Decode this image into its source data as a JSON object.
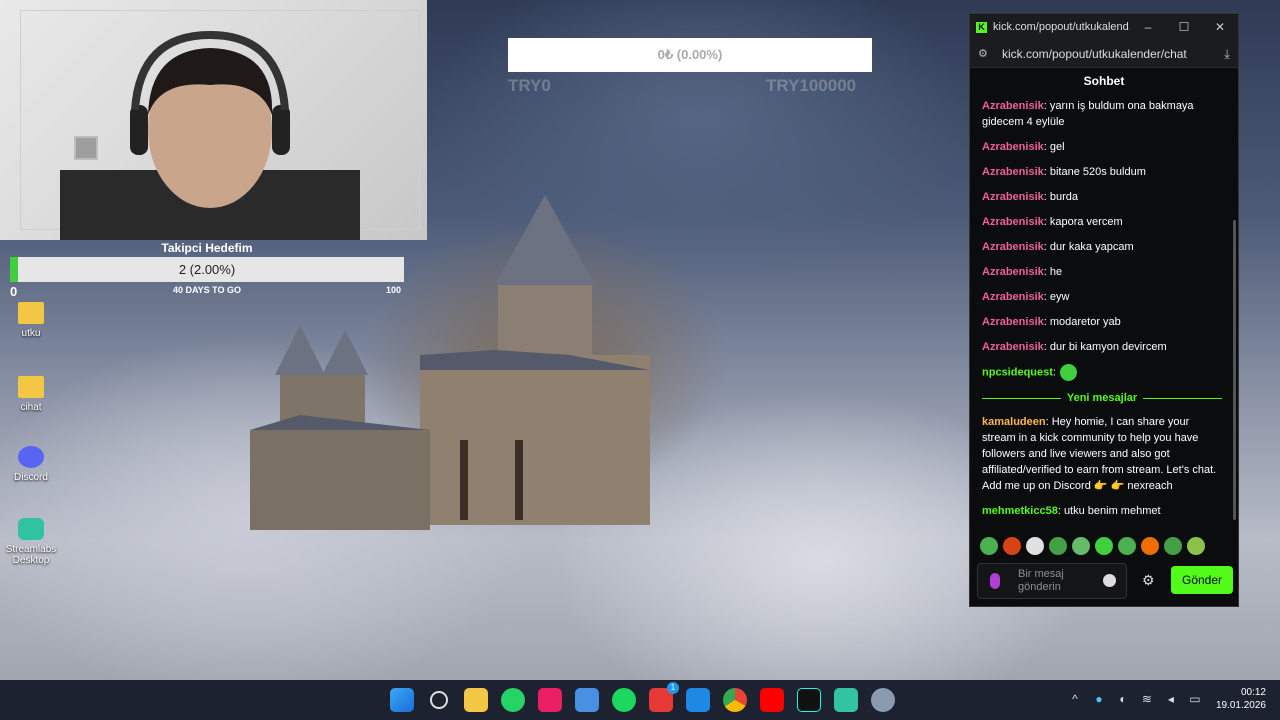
{
  "webcam": {
    "label": "webcam-feed"
  },
  "donation_goal": {
    "value": "0₺ (0.00%)",
    "min": "TRY0",
    "max": "TRY100000"
  },
  "follower_goal": {
    "title": "Takipci Hedefim",
    "value": "2 (2.00%)",
    "progress": 0.02,
    "min": "0",
    "days": "40 DAYS TO GO",
    "max": "100"
  },
  "desktop_icons": [
    {
      "label": "utku",
      "icon": "folder-icon"
    },
    {
      "label": "cihat",
      "icon": "folder-icon"
    },
    {
      "label": "Discord",
      "icon": "discord-icon"
    },
    {
      "label": "Streamlabs Desktop",
      "icon": "streamlabs-icon"
    }
  ],
  "popup": {
    "window_title": "kick.com/popout/utkukalend...",
    "url": "kick.com/popout/utkukalender/chat",
    "header": "Sohbet",
    "messages": [
      {
        "user": "Azrabenisik",
        "color": "#f06292",
        "text": ": yarın iş buldum ona bakmaya gidecem 4 eylüle"
      },
      {
        "user": "Azrabenisik",
        "color": "#f06292",
        "text": ": gel"
      },
      {
        "user": "Azrabenisik",
        "color": "#f06292",
        "text": ": bitane 520s buldum"
      },
      {
        "user": "Azrabenisik",
        "color": "#f06292",
        "text": ": burda"
      },
      {
        "user": "Azrabenisik",
        "color": "#f06292",
        "text": ": kapora vercem"
      },
      {
        "user": "Azrabenisik",
        "color": "#f06292",
        "text": ": dur kaka yapcam"
      },
      {
        "user": "Azrabenisik",
        "color": "#f06292",
        "text": ": he"
      },
      {
        "user": "Azrabenisik",
        "color": "#f06292",
        "text": ": eyw"
      },
      {
        "user": "Azrabenisik",
        "color": "#f06292",
        "text": ": modaretor yab"
      },
      {
        "user": "Azrabenisik",
        "color": "#f06292",
        "text": ": dur bi kamyon devircem"
      },
      {
        "user": "npcsidequest",
        "color": "#53fc18",
        "text": ":"
      }
    ],
    "new_messages_label": "Yeni mesajlar",
    "new_messages": [
      {
        "user": "kamaludeen",
        "color": "#ffb74d",
        "text": ": Hey homie, I can share your stream in a kick community to help you have followers and live viewers and also got affiliated/verified to earn from stream. Let's chat. Add me up on Discord 👉 👉  nexreach"
      },
      {
        "user": "mehmetkicc58",
        "color": "#53fc18",
        "text": ": utku benim mehmet"
      }
    ],
    "input_placeholder": "Bir mesaj gönderin",
    "send_label": "Gönder"
  },
  "taskbar": {
    "apps": [
      "windows-start-icon",
      "search-icon",
      "file-explorer-icon",
      "whatsapp-icon",
      "tiktok-studio-icon",
      "store-icon",
      "spotify-icon",
      "app-l-icon",
      "app-blue-icon",
      "chrome-icon",
      "youtube-icon",
      "tiktok-icon",
      "streamlabs-icon",
      "settings-icon"
    ],
    "badge": "1",
    "time": "00:12",
    "date": "19.01.2026"
  },
  "colors": {
    "kick_green": "#53fc18",
    "chat_bg": "#0b0c0e"
  }
}
